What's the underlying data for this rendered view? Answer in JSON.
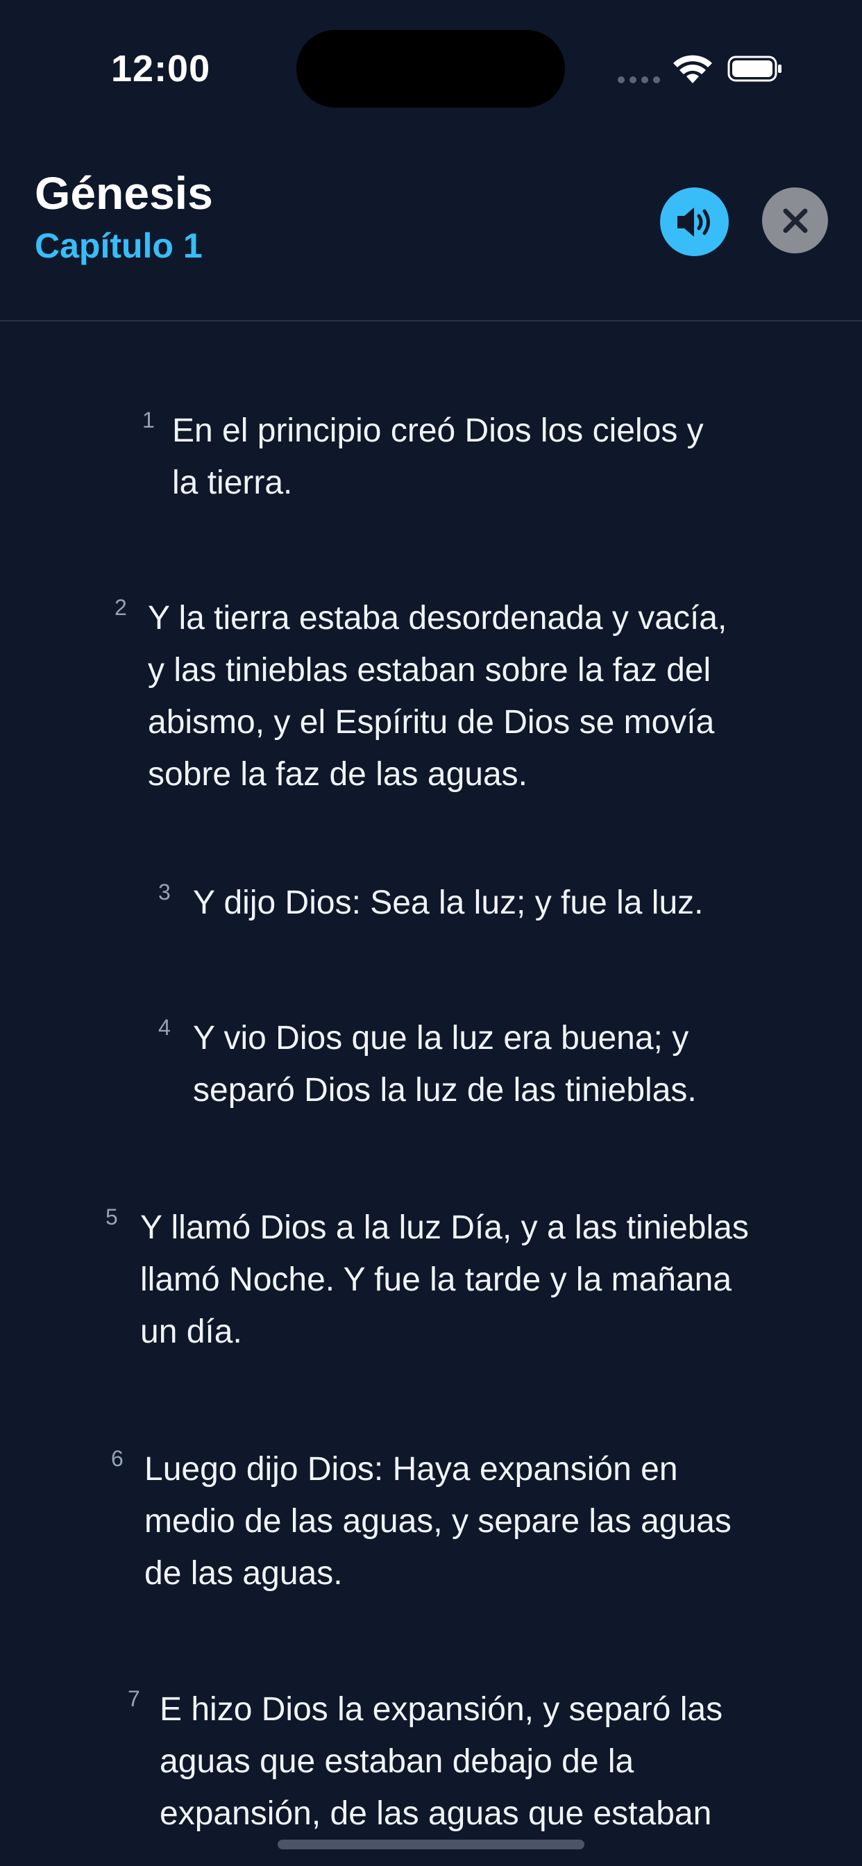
{
  "status_bar": {
    "time": "12:00"
  },
  "header": {
    "book": "Génesis",
    "chapter": "Capítulo 1",
    "audio_icon": "speaker-icon",
    "close_icon": "close-icon"
  },
  "colors": {
    "background": "#0f172a",
    "accent": "#38bdf8",
    "verse_number": "#94a3b8",
    "close_button": "#8a8d93"
  },
  "verses": [
    {
      "num": "1",
      "lines": [
        "En el principio creó Dios los cielos y",
        "la tierra."
      ]
    },
    {
      "num": "2",
      "lines": [
        "Y la tierra estaba desordenada y vacía,",
        "y las tinieblas estaban sobre la faz del",
        "abismo, y el Espíritu de Dios se movía",
        "sobre la faz de las aguas."
      ]
    },
    {
      "num": "3",
      "lines": [
        "Y dijo Dios: Sea la luz; y fue la luz."
      ]
    },
    {
      "num": "4",
      "lines": [
        "Y vio Dios que la luz era buena; y",
        "separó Dios la luz de las tinieblas."
      ]
    },
    {
      "num": "5",
      "lines": [
        "Y llamó Dios a la luz Día, y a las tinieblas",
        "llamó Noche. Y fue la tarde y la mañana",
        "un día."
      ]
    },
    {
      "num": "6",
      "lines": [
        "Luego dijo Dios: Haya expansión en",
        "medio de las aguas, y separe las aguas",
        "de las aguas."
      ]
    },
    {
      "num": "7",
      "lines": [
        "E hizo Dios la expansión, y separó las",
        "aguas que estaban debajo de la",
        "expansión, de las aguas que estaban"
      ]
    }
  ]
}
